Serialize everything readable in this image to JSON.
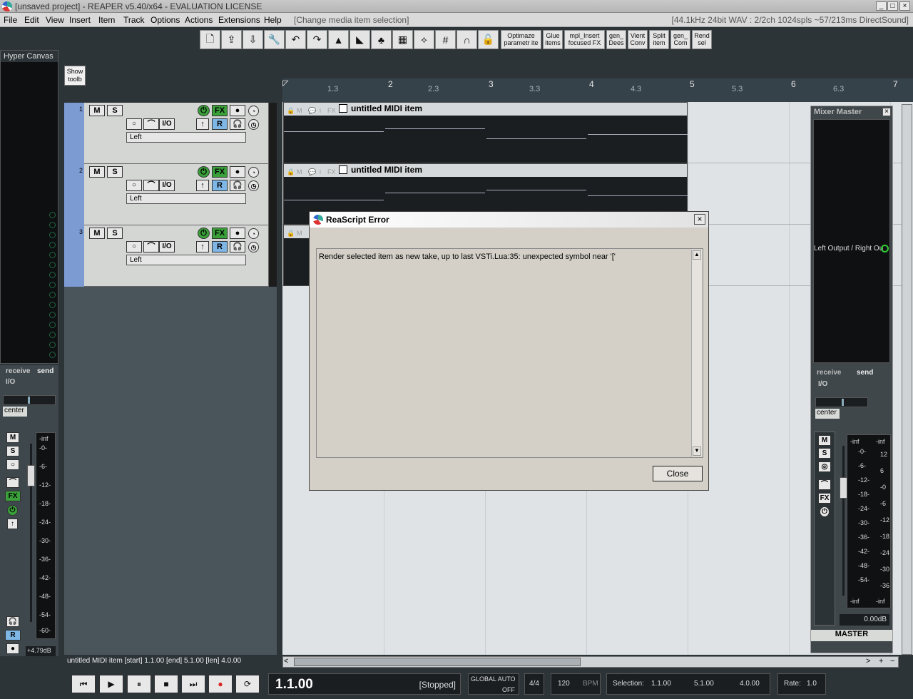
{
  "window": {
    "title": "[unsaved project] - REAPER v5.40/x64 - EVALUATION LICENSE",
    "min": "_",
    "max": "□",
    "close": "×"
  },
  "menu": {
    "items": [
      "File",
      "Edit",
      "View",
      "Insert",
      "Item",
      "Track",
      "Options",
      "Actions",
      "Extensions",
      "Help"
    ],
    "hint": "[Change media item selection]",
    "status": "[44.1kHz 24bit WAV : 2/2ch 1024spls ~57/213ms DirectSound]"
  },
  "toolbar": {
    "icons": [
      "new-icon",
      "open-icon",
      "save-icon",
      "wrench-icon",
      "undo-icon",
      "redo-icon",
      "metronome-icon",
      "ripple-icon",
      "clover-icon",
      "grid-icon",
      "envelope-icon",
      "snap-grid-icon",
      "magnet-icon",
      "lock-icon"
    ],
    "text_buttons": [
      [
        "Optimaze",
        "parametr ite"
      ],
      [
        "Glue",
        "items"
      ],
      [
        "mpl_Insert",
        "focused FX"
      ],
      [
        "gen_",
        "Dees"
      ],
      [
        "Vient",
        "Conv"
      ],
      [
        "Split",
        "item"
      ],
      [
        "gen_",
        "Com"
      ],
      [
        "Rend",
        "sel"
      ]
    ]
  },
  "hyper": {
    "title": "Hyper Canvas"
  },
  "showtoolbar": {
    "l1": "Show",
    "l2": "toolb"
  },
  "ruler": {
    "major": [
      "1",
      "2",
      "3",
      "4",
      "5",
      "6",
      "7"
    ],
    "minor": [
      "1.3",
      "2.3",
      "3.3",
      "4.3",
      "5.3",
      "6.3"
    ]
  },
  "tracks": [
    {
      "number": "1",
      "mute": "M",
      "solo": "S",
      "fx": "FX",
      "io": "I/O",
      "rin": "R",
      "name": "Left"
    },
    {
      "number": "2",
      "mute": "M",
      "solo": "S",
      "fx": "FX",
      "io": "I/O",
      "rin": "R",
      "name": "Left"
    },
    {
      "number": "3",
      "mute": "M",
      "solo": "S",
      "fx": "FX",
      "io": "I/O",
      "rin": "R",
      "name": "Left"
    }
  ],
  "items": [
    {
      "name": "untitled MIDI item",
      "m": "M",
      "fx": "FX",
      "i": "i"
    },
    {
      "name": "untitled MIDI item",
      "m": "M",
      "fx": "FX",
      "i": "i"
    },
    {
      "name": "",
      "m": "M",
      "fx": "",
      "i": ""
    }
  ],
  "dialog": {
    "title": "ReaScript Error",
    "message": "Render selected item as new take, up to last VSTi.Lua:35: unexpected symbol near '['",
    "close": "Close"
  },
  "mixer": {
    "title": "Mixer Master",
    "output": "Left Output / Right Ou",
    "receive": "receive",
    "send": "send",
    "io": "I/O",
    "pan": "center",
    "gain": "0.00dB",
    "label": "MASTER",
    "scale_l": [
      "-inf",
      "-0-",
      "-6-",
      "-12-",
      "-18-",
      "-24-",
      "-30-",
      "-36-",
      "-42-",
      "-48-",
      "-54-",
      "-inf"
    ],
    "scale_r": [
      "-inf",
      "12",
      "6",
      "-0",
      "-6",
      "-12",
      "-18",
      "-24",
      "-30",
      "-36",
      "-42",
      "-inf"
    ],
    "scale_mid": [
      "12",
      "6",
      "0-",
      "6-",
      "12-",
      "18-",
      "24-",
      "30-",
      "36-",
      "42-"
    ]
  },
  "leftstrip": {
    "receive": "receive",
    "send": "send",
    "io": "I/O",
    "pan": "center",
    "meter_top": "-inf",
    "gain": "+4.79dB",
    "m": "M",
    "s": "S",
    "fx": "FX",
    "rin": "R",
    "scale": [
      "-0-",
      "-6-",
      "-12-",
      "-18-",
      "-24-",
      "-30-",
      "-36-",
      "-42-",
      "-48-",
      "-54-",
      "-60-"
    ]
  },
  "status": {
    "tcp": "untitled MIDI item [start] 1.1.00 [end] 5.1.00 [len] 4.0.00",
    "page": "1"
  },
  "transport": {
    "position": "1.1.00",
    "state": "[Stopped]",
    "global_auto": "GLOBAL AUTO",
    "auto_state": "OFF",
    "timesig": "4/4",
    "bpm": "120",
    "bpm_label": "BPM",
    "sel_label": "Selection:",
    "sel_start": "1.1.00",
    "sel_end": "5.1.00",
    "sel_len": "4.0.00",
    "rate_label": "Rate:",
    "rate": "1.0"
  }
}
